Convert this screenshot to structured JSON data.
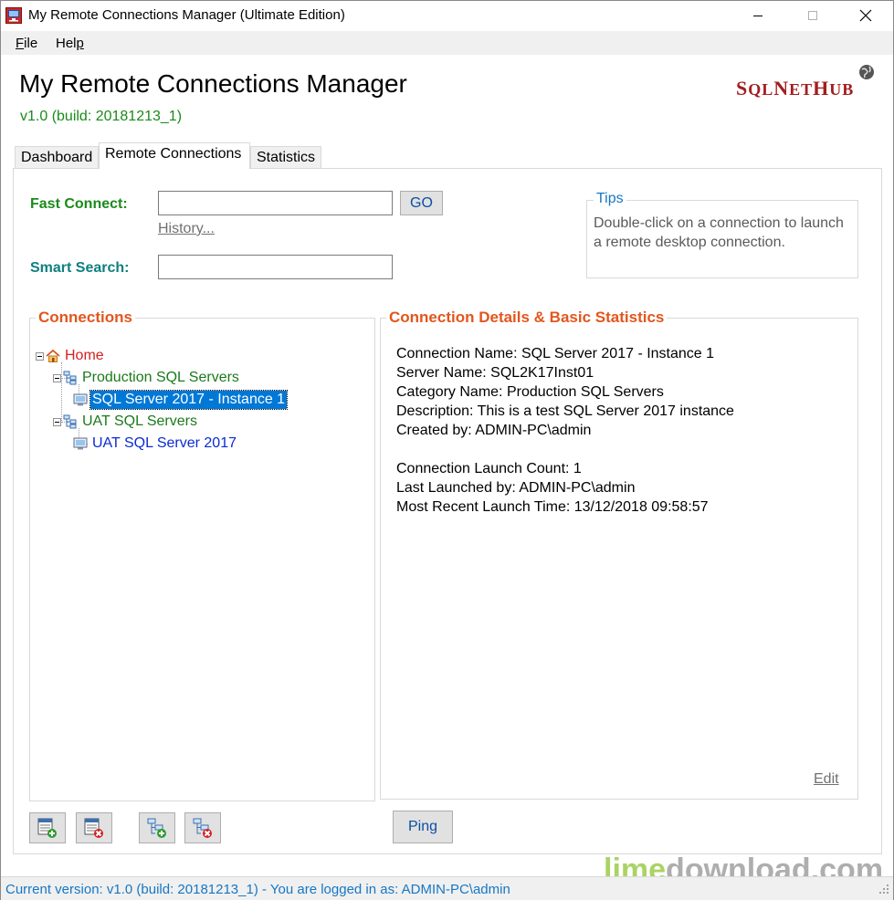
{
  "window": {
    "title": "My Remote Connections Manager (Ultimate Edition)"
  },
  "menu": {
    "file_ul": "F",
    "file_rest": "ile",
    "help_pre": "Hel",
    "help_ul": "p"
  },
  "header": {
    "app_title": "My Remote Connections Manager",
    "version": "v1.0 (build: 20181213_1)",
    "logo_s": "S",
    "logo_ql": "QL",
    "logo_n": "N",
    "logo_et": "ET",
    "logo_h": "H",
    "logo_ub": "UB"
  },
  "tabs": [
    {
      "label": "Dashboard"
    },
    {
      "label": "Remote Connections",
      "active": true
    },
    {
      "label": "Statistics"
    }
  ],
  "fast_connect": {
    "label": "Fast Connect:",
    "value": "",
    "go_label": "GO",
    "history_label": "History..."
  },
  "smart_search": {
    "label": "Smart Search:",
    "value": ""
  },
  "tips": {
    "title": "Tips",
    "text": "Double-click on a connection to launch a remote desktop connection."
  },
  "connections": {
    "title": "Connections",
    "tree": {
      "root": "Home",
      "categories": [
        {
          "name": "Production SQL Servers",
          "items": [
            "SQL Server 2017 - Instance 1"
          ]
        },
        {
          "name": "UAT SQL Servers",
          "items": [
            "UAT SQL Server 2017"
          ]
        }
      ],
      "selected": "SQL Server 2017 - Instance 1"
    }
  },
  "details": {
    "title": "Connection Details & Basic Statistics",
    "lines": [
      "Connection Name: SQL Server 2017 - Instance 1",
      "Server Name: SQL2K17Inst01",
      "Category Name: Production SQL Servers",
      "Description: This is a test SQL Server 2017 instance",
      "Created by: ADMIN-PC\\admin",
      "Connection Launch Count: 1",
      "Last Launched by: ADMIN-PC\\admin",
      "Most Recent Launch Time: 13/12/2018 09:58:57"
    ],
    "edit_label": "Edit"
  },
  "buttons": {
    "ping_label": "Ping"
  },
  "icons": {
    "add_connection": "add-connection-icon",
    "delete_connection": "delete-connection-icon",
    "add_category": "add-category-icon",
    "delete_category": "delete-category-icon"
  },
  "status": {
    "text": "Current version: v1.0 (build: 20181213_1) - You are logged in as: ADMIN-PC\\admin"
  },
  "watermark": {
    "lime": "lime",
    "download": "download.com"
  },
  "colors": {
    "accent_green": "#1a8a1a",
    "accent_orange": "#e2561e",
    "link_blue": "#0a2bd1",
    "selection": "#0078d7",
    "status_blue": "#1777c4"
  }
}
